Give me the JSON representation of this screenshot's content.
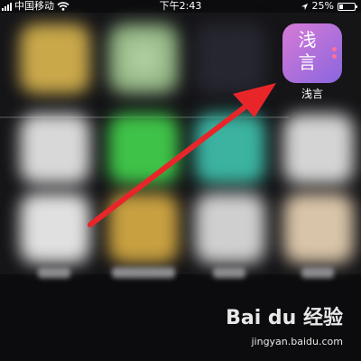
{
  "status_bar": {
    "carrier": "中国移动",
    "time": "下午2:43",
    "battery_percent": "25%",
    "battery_level": 0.25
  },
  "app": {
    "name": "浅言",
    "icon_glyph_line1": "浅",
    "icon_glyph_line2": "言",
    "icon_gradient_start": "#d77bd6",
    "icon_gradient_end": "#8a66df"
  },
  "annotation": {
    "arrow_color": "#e8262a",
    "points_to": "app-icon"
  },
  "watermark": {
    "logo": "Bai du 经验",
    "url": "jingyan.baidu.com"
  }
}
